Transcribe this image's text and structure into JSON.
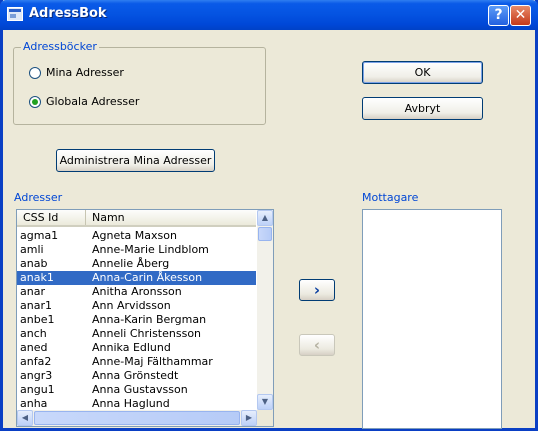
{
  "window": {
    "title": "AdressBok"
  },
  "address_books": {
    "legend": "Adressböcker",
    "options": [
      {
        "label": "Mina Adresser",
        "checked": false
      },
      {
        "label": "Globala Adresser",
        "checked": true
      }
    ]
  },
  "buttons": {
    "ok": "OK",
    "cancel": "Avbryt",
    "manage": "Administrera Mina Adresser",
    "add_arrow": "›",
    "remove_arrow": "‹"
  },
  "addresses": {
    "label": "Adresser",
    "columns": [
      "CSS Id",
      "Namn"
    ],
    "rows": [
      {
        "id": "agma1",
        "name": "Agneta Maxson"
      },
      {
        "id": "amli",
        "name": "Anne-Marie Lindblom"
      },
      {
        "id": "anab",
        "name": "Annelie Åberg"
      },
      {
        "id": "anak1",
        "name": "Anna-Carin Åkesson",
        "selected": true
      },
      {
        "id": "anar",
        "name": "Anitha Aronsson"
      },
      {
        "id": "anar1",
        "name": "Ann Arvidsson"
      },
      {
        "id": "anbe1",
        "name": "Anna-Karin Bergman"
      },
      {
        "id": "anch",
        "name": "Anneli Christensson"
      },
      {
        "id": "aned",
        "name": "Annika Edlund"
      },
      {
        "id": "anfa2",
        "name": "Anne-Maj Fälthammar"
      },
      {
        "id": "angr3",
        "name": "Anna Grönstedt"
      },
      {
        "id": "angu1",
        "name": "Anna Gustavsson"
      },
      {
        "id": "anha",
        "name": "Anna Haglund"
      }
    ]
  },
  "recipients": {
    "label": "Mottagare"
  },
  "colors": {
    "titlebar": "#0554e2",
    "selection": "#316ac5",
    "group_text": "#0046d5"
  }
}
